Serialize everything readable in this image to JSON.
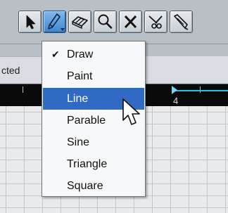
{
  "toolbar": {
    "tools": [
      {
        "name": "arrow-tool",
        "icon": "arrow-icon",
        "active": false
      },
      {
        "name": "draw-tool",
        "icon": "pencil-icon",
        "active": true
      },
      {
        "name": "erase-tool",
        "icon": "eraser-icon",
        "active": false
      },
      {
        "name": "zoom-tool",
        "icon": "magnifier-icon",
        "active": false
      },
      {
        "name": "mute-tool",
        "icon": "x-icon",
        "active": false
      },
      {
        "name": "split-tool",
        "icon": "scissors-icon",
        "active": false
      },
      {
        "name": "glue-tool",
        "icon": "glue-icon",
        "active": false
      }
    ]
  },
  "panel": {
    "track_label": "cted",
    "ruler_label": "4"
  },
  "menu": {
    "items": [
      {
        "label": "Draw",
        "checked": true
      },
      {
        "label": "Paint"
      },
      {
        "label": "Line",
        "highlighted": true
      },
      {
        "label": "Parable"
      },
      {
        "label": "Sine"
      },
      {
        "label": "Triangle"
      },
      {
        "label": "Square"
      }
    ],
    "check_glyph": "✔"
  },
  "colors": {
    "active_tool": "#3f86d0",
    "menu_highlight": "#316ac5",
    "locator": "#1fc2e6"
  }
}
